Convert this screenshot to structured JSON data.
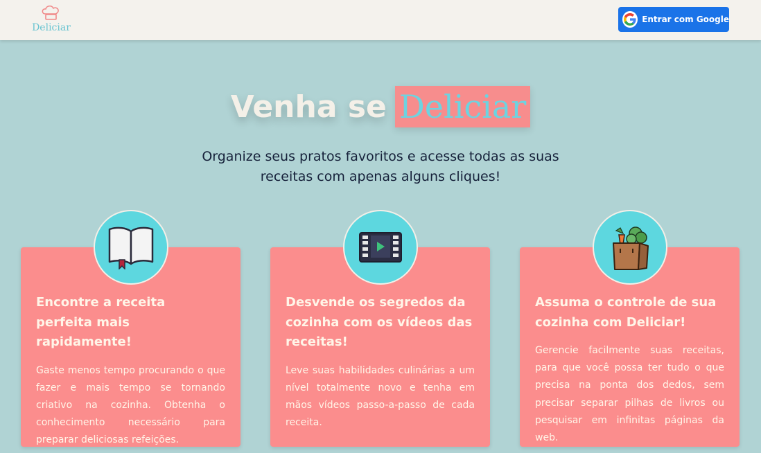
{
  "header": {
    "logo_text": "Deliciar",
    "login_button": "Entrar com Google"
  },
  "hero": {
    "title_prefix": "Venha se",
    "title_brand": "Deliciar",
    "subtitle_line1": "Organize seus pratos favoritos e acesse todas as suas",
    "subtitle_line2": "receitas com apenas alguns cliques!"
  },
  "features": [
    {
      "icon": "book-icon",
      "title": "Encontre a receita perfeita mais rapidamente!",
      "text": "Gaste menos tempo procurando o que fazer e mais tempo se tornando criativo na cozinha. Obtenha o conhecimento necessário para preparar deliciosas refeições."
    },
    {
      "icon": "film-icon",
      "title": "Desvende os segredos da cozinha com os vídeos das receitas!",
      "text": "Leve suas habilidades culinárias a um nível totalmente novo e tenha em mãos vídeos passo-a-passo de cada receita."
    },
    {
      "icon": "grocery-bag-icon",
      "title": "Assuma o controle de sua cozinha com Deliciar!",
      "text": "Gerencie facilmente suas receitas, para que você possa ter tudo o que precisa na ponta dos dedos, sem precisar separar pilhas de livros ou pesquisar em infinitas páginas da web."
    }
  ],
  "colors": {
    "background": "#b0d3d4",
    "header_bg": "#f4f2ed",
    "card_bg": "#fb8d8d",
    "accent_teal": "#5dd7df",
    "google_blue": "#1a73e8"
  }
}
